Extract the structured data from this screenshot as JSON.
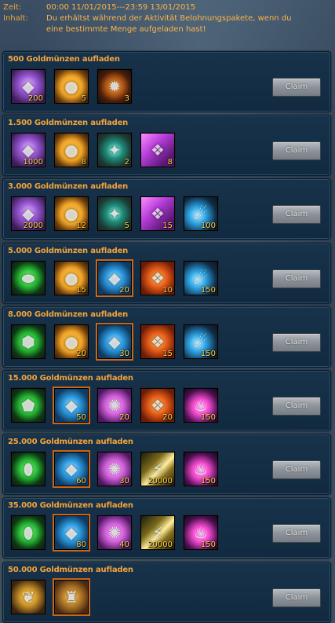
{
  "header": {
    "time_label": "Zeit:",
    "time_value": "00:00 11/01/2015---23:59 13/01/2015",
    "content_label": "Inhalt:",
    "content_value": "Du erhältst während der Aktivität Belohnungspakete, wenn du eine bestimmte Menge aufgeladen hast!"
  },
  "claim_label": "Claim",
  "colors": {
    "accent": "#f3a43b",
    "count": "#ffd24a",
    "panel": "#13304a"
  },
  "tiers": [
    {
      "title": "500 Goldmünzen aufladen",
      "items": [
        {
          "icon": "purple-crystal-icon",
          "cls": "ic-crystal",
          "glyph": "◆",
          "count": "200",
          "orange": false
        },
        {
          "icon": "gold-coin-icon",
          "cls": "ic-coin",
          "glyph": "●",
          "count": "5",
          "orange": false
        },
        {
          "icon": "fire-orb-icon",
          "cls": "ic-fire-orb",
          "glyph": "✹",
          "count": "3",
          "orange": false
        }
      ]
    },
    {
      "title": "1.500 Goldmünzen aufladen",
      "items": [
        {
          "icon": "purple-crystal-icon",
          "cls": "ic-crystal",
          "glyph": "◆",
          "count": "1000",
          "orange": false
        },
        {
          "icon": "gold-coin-icon",
          "cls": "ic-coin",
          "glyph": "●",
          "count": "8",
          "orange": false
        },
        {
          "icon": "teal-gem-icon",
          "cls": "ic-teal-gem",
          "glyph": "✦",
          "count": "2",
          "orange": false
        },
        {
          "icon": "purple-scroll-icon",
          "cls": "ic-purple-scroll",
          "glyph": "❖",
          "count": "8",
          "orange": false
        }
      ]
    },
    {
      "title": "3.000 Goldmünzen aufladen",
      "items": [
        {
          "icon": "purple-crystal-icon",
          "cls": "ic-crystal",
          "glyph": "◆",
          "count": "2000",
          "orange": false
        },
        {
          "icon": "gold-coin-icon",
          "cls": "ic-coin",
          "glyph": "●",
          "count": "12",
          "orange": false
        },
        {
          "icon": "teal-gem-icon",
          "cls": "ic-teal-gem",
          "glyph": "✦",
          "count": "5",
          "orange": false
        },
        {
          "icon": "purple-scroll-icon",
          "cls": "ic-purple-scroll",
          "glyph": "❖",
          "count": "15",
          "orange": false
        },
        {
          "icon": "blue-comet-icon",
          "cls": "ic-blue-comet",
          "glyph": "☄",
          "count": "100",
          "orange": false
        }
      ]
    },
    {
      "title": "5.000 Goldmünzen aufladen",
      "items": [
        {
          "icon": "green-gem-icon",
          "cls": "ic-green-gem",
          "glyph": "⬬",
          "count": "",
          "orange": false
        },
        {
          "icon": "gold-coin-icon",
          "cls": "ic-coin",
          "glyph": "●",
          "count": "15",
          "orange": false
        },
        {
          "icon": "blue-gem-icon",
          "cls": "ic-blue-gem",
          "glyph": "◆",
          "count": "20",
          "orange": true
        },
        {
          "icon": "fire-scroll-icon",
          "cls": "ic-fire-scroll",
          "glyph": "❖",
          "count": "10",
          "orange": false
        },
        {
          "icon": "blue-comet-icon",
          "cls": "ic-blue-comet",
          "glyph": "☄",
          "count": "150",
          "orange": false
        }
      ]
    },
    {
      "title": "8.000 Goldmünzen aufladen",
      "items": [
        {
          "icon": "green-gem-icon",
          "cls": "ic-green-gem",
          "glyph": "⬢",
          "count": "",
          "orange": false
        },
        {
          "icon": "gold-coin-icon",
          "cls": "ic-coin",
          "glyph": "●",
          "count": "20",
          "orange": false
        },
        {
          "icon": "blue-gem-icon",
          "cls": "ic-blue-gem",
          "glyph": "◆",
          "count": "30",
          "orange": true
        },
        {
          "icon": "fire-scroll-icon",
          "cls": "ic-fire-scroll",
          "glyph": "❖",
          "count": "15",
          "orange": false
        },
        {
          "icon": "blue-comet-icon",
          "cls": "ic-blue-comet",
          "glyph": "☄",
          "count": "150",
          "orange": false
        }
      ]
    },
    {
      "title": "15.000 Goldmünzen aufladen",
      "items": [
        {
          "icon": "green-gem-icon",
          "cls": "ic-green-gem",
          "glyph": "⬟",
          "count": "",
          "orange": false
        },
        {
          "icon": "blue-gem-icon",
          "cls": "ic-blue-gem",
          "glyph": "◆",
          "count": "50",
          "orange": true
        },
        {
          "icon": "pink-orb-icon",
          "cls": "ic-pink-orb",
          "glyph": "✺",
          "count": "20",
          "orange": false
        },
        {
          "icon": "fire-scroll-icon",
          "cls": "ic-fire-scroll",
          "glyph": "❖",
          "count": "20",
          "orange": false
        },
        {
          "icon": "pink-flame-icon",
          "cls": "ic-pink-flame",
          "glyph": "♨",
          "count": "150",
          "orange": false
        }
      ]
    },
    {
      "title": "25.000 Goldmünzen aufladen",
      "items": [
        {
          "icon": "green-gem-icon",
          "cls": "ic-green-gem",
          "glyph": "⬮",
          "count": "",
          "orange": false
        },
        {
          "icon": "blue-gem-icon",
          "cls": "ic-blue-gem",
          "glyph": "◆",
          "count": "60",
          "orange": true
        },
        {
          "icon": "pink-orb-icon",
          "cls": "ic-pink-orb",
          "glyph": "✺",
          "count": "30",
          "orange": false
        },
        {
          "icon": "gold-slash-icon",
          "cls": "ic-gold-slash",
          "glyph": "⚡",
          "count": "20000",
          "orange": false
        },
        {
          "icon": "pink-flame-icon",
          "cls": "ic-pink-flame",
          "glyph": "♨",
          "count": "150",
          "orange": false
        }
      ]
    },
    {
      "title": "35.000 Goldmünzen aufladen",
      "items": [
        {
          "icon": "green-gem-icon",
          "cls": "ic-green-gem",
          "glyph": "⬮",
          "count": "",
          "orange": false
        },
        {
          "icon": "blue-gem-icon",
          "cls": "ic-blue-gem",
          "glyph": "◆",
          "count": "80",
          "orange": true
        },
        {
          "icon": "pink-orb-icon",
          "cls": "ic-pink-orb",
          "glyph": "✺",
          "count": "40",
          "orange": false
        },
        {
          "icon": "gold-slash-icon",
          "cls": "ic-gold-slash",
          "glyph": "⚡",
          "count": "20000",
          "orange": false
        },
        {
          "icon": "pink-flame-icon",
          "cls": "ic-pink-flame",
          "glyph": "♨",
          "count": "150",
          "orange": false
        }
      ]
    },
    {
      "title": "50.000 Goldmünzen aufladen",
      "items": [
        {
          "icon": "golden-wings-icon",
          "cls": "ic-wings",
          "glyph": "❦",
          "count": "",
          "orange": false
        },
        {
          "icon": "golden-armor-icon",
          "cls": "ic-armor",
          "glyph": "♜",
          "count": "",
          "orange": true
        }
      ]
    }
  ]
}
